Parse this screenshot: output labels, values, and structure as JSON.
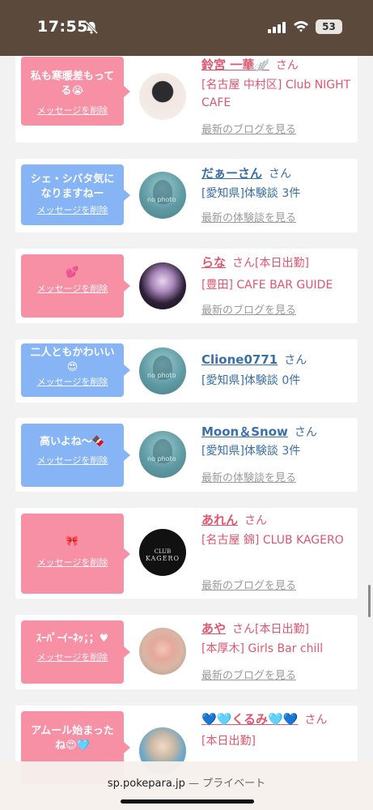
{
  "status": {
    "time": "17:55",
    "battery": "53"
  },
  "posts": [
    {
      "message": "私も寒暖差もってる😭",
      "delete": "メッセージを削除",
      "name": "鈴宮 一華🪽",
      "san": "さん",
      "badge": "",
      "shop": "[名古屋 中村区] Club NIGHT CAFE",
      "latest": "最新のブログを見る"
    },
    {
      "message": "シェ・シバタ気になりますねー",
      "delete": "メッセージを削除",
      "name": "だぁーさん",
      "san": "さん",
      "badge": "",
      "shop": "[愛知県]体験談 3件",
      "latest": "最新の体験談を見る"
    },
    {
      "message": "💕",
      "delete": "メッセージを削除",
      "name": "らな",
      "san": "さん",
      "badge": "[本日出勤]",
      "shop": "[豊田] CAFE BAR GUIDE",
      "latest": "最新のブログを見る"
    },
    {
      "message": "二人ともかわいい😍",
      "delete": "メッセージを削除",
      "name": "Clione0771",
      "san": "さん",
      "badge": "",
      "shop": "[愛知県]体験談 0件",
      "latest": ""
    },
    {
      "message": "高いよね〜🍫",
      "delete": "メッセージを削除",
      "name": "Moon＆Snow",
      "san": "さん",
      "badge": "",
      "shop": "[愛知県]体験談 3件",
      "latest": "最新の体験談を見る"
    },
    {
      "message": "🎀",
      "delete": "メッセージを削除",
      "name": "あれん",
      "san": "さん",
      "badge": "",
      "shop": "[名古屋 錦] CLUB KAGERO",
      "latest": "最新のブログを見る"
    },
    {
      "message": "ｽｰﾊﾟｰｲｰﾈｯ；；♥",
      "delete": "メッセージを削除",
      "name": "あや",
      "san": "さん",
      "badge": "[本日出勤]",
      "shop": "[本厚木] Girls Bar chill",
      "latest": "最新のブログを見る"
    },
    {
      "message": "アムール始まったね😍🩵",
      "delete": "",
      "name": "💙🩵くるみ🩵💙",
      "san": "さん",
      "badge": "",
      "shop": "[本日出勤]",
      "latest": ""
    }
  ],
  "avatars": {
    "nophoto": "no photo",
    "kagero_top": "CLUB",
    "kagero_name": "KAGERO"
  },
  "browser": {
    "domain": "sp.pokepara.jp",
    "mode": "— プライベート"
  },
  "colors": {
    "status_bg": "#5b4a3c",
    "pink_bubble": "#f78fa5",
    "blue_bubble": "#86b4f5",
    "girl_name": "#e0566f",
    "user_name": "#3a6fa8"
  }
}
